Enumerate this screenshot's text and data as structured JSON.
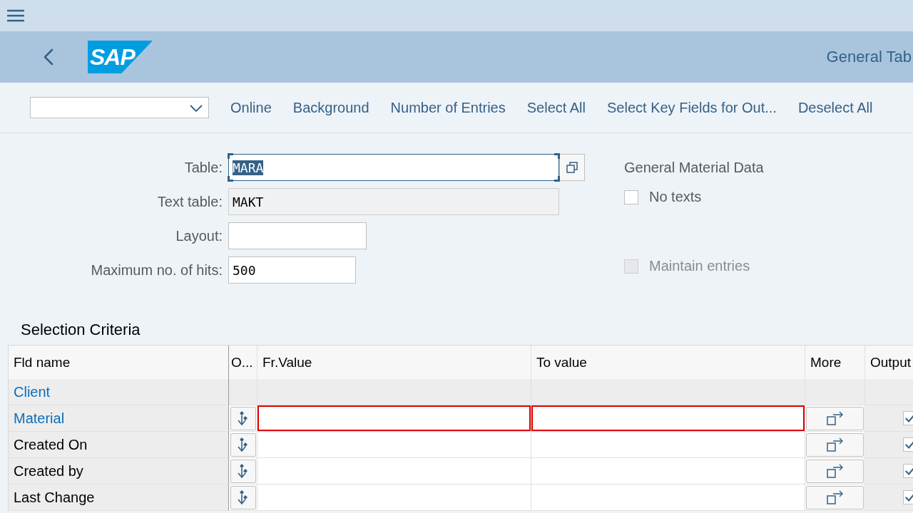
{
  "header": {
    "logo": "SAP",
    "title": "General Tab"
  },
  "toolbar": {
    "buttons": [
      "Online",
      "Background",
      "Number of Entries",
      "Select All",
      "Select Key Fields for Out...",
      "Deselect All"
    ]
  },
  "form": {
    "fields": [
      {
        "label": "Table:",
        "value": "MARA",
        "kind": "lookup",
        "highlighted": true
      },
      {
        "label": "Text table:",
        "value": "MAKT",
        "kind": "readonly"
      },
      {
        "label": "Layout:",
        "kind": "input"
      },
      {
        "label": "Maximum no. of hits:",
        "value": "500",
        "kind": "input"
      }
    ]
  },
  "options": {
    "title": "General Material Data",
    "checkboxes": [
      {
        "label": "No texts",
        "checked": false,
        "disabled": false
      },
      {
        "label": "Maintain entries",
        "checked": false,
        "disabled": true
      }
    ]
  },
  "selection": {
    "title": "Selection Criteria",
    "columns": [
      "Fld name",
      "O...",
      "Fr.Value",
      "To value",
      "More",
      "Output"
    ],
    "rows": [
      {
        "name": "Client",
        "kind": "header",
        "link": true
      },
      {
        "name": "Material",
        "kind": "field",
        "link": true,
        "error": true,
        "output": true
      },
      {
        "name": "Created On",
        "kind": "field",
        "link": false,
        "error": false,
        "output": true
      },
      {
        "name": "Created by",
        "kind": "field",
        "link": false,
        "error": false,
        "output": true
      },
      {
        "name": "Last Change",
        "kind": "field",
        "link": false,
        "error": false,
        "output": true
      }
    ]
  }
}
